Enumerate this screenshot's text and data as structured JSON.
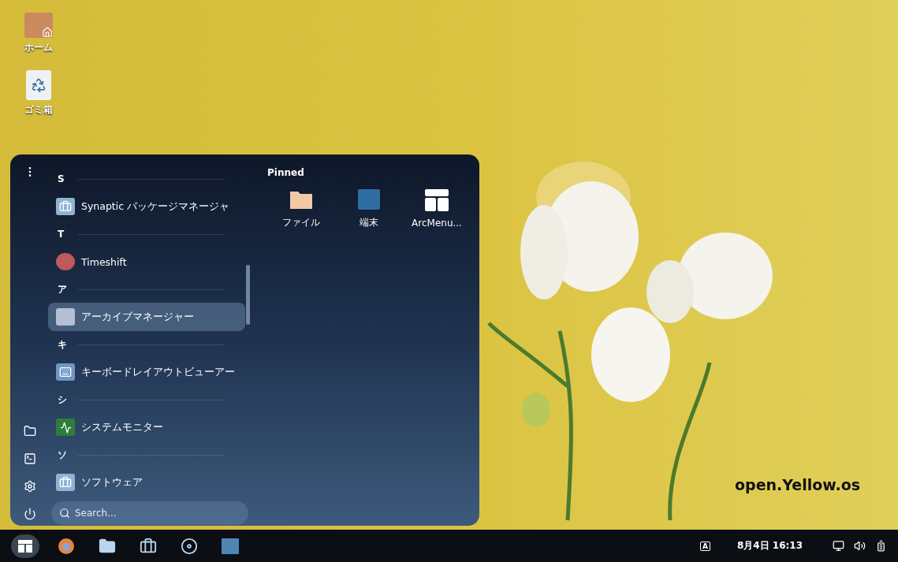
{
  "desktop_icons": [
    {
      "kind": "home",
      "label": "ホーム"
    },
    {
      "kind": "trash",
      "label": "ゴミ箱"
    }
  ],
  "menu": {
    "apps": [
      {
        "kind": "header",
        "label": "S"
      },
      {
        "kind": "package",
        "label": "Synaptic パッケージマネージャ",
        "selected": false
      },
      {
        "kind": "header",
        "label": "T"
      },
      {
        "kind": "timeshift",
        "label": "Timeshift",
        "selected": false
      },
      {
        "kind": "header",
        "label": "ア"
      },
      {
        "kind": "archive",
        "label": "アーカイブマネージャー",
        "selected": true
      },
      {
        "kind": "header",
        "label": "キ"
      },
      {
        "kind": "keyboard",
        "label": "キーボードレイアウトビューアー",
        "selected": false
      },
      {
        "kind": "header",
        "label": "シ"
      },
      {
        "kind": "monitor",
        "label": "システムモニター",
        "selected": false
      },
      {
        "kind": "header",
        "label": "ソ"
      },
      {
        "kind": "package",
        "label": "ソフトウェア",
        "selected": false
      }
    ],
    "pinned_title": "Pinned",
    "pinned": [
      {
        "kind": "folder",
        "label": "ファイル"
      },
      {
        "kind": "terminal",
        "label": "端末"
      },
      {
        "kind": "layout",
        "label": "ArcMenu..."
      }
    ],
    "search": {
      "placeholder": "Search..."
    }
  },
  "wallpaper_text": "open.Yellow.os",
  "taskbar": {
    "apps": [
      {
        "kind": "menu",
        "selected": true
      },
      {
        "kind": "browser",
        "selected": false
      },
      {
        "kind": "folder",
        "selected": false
      },
      {
        "kind": "package",
        "selected": false
      },
      {
        "kind": "disc",
        "selected": false
      },
      {
        "kind": "terminal",
        "selected": false
      }
    ],
    "keyboard_indicator": "A",
    "clock": "8月4日 16:13"
  }
}
